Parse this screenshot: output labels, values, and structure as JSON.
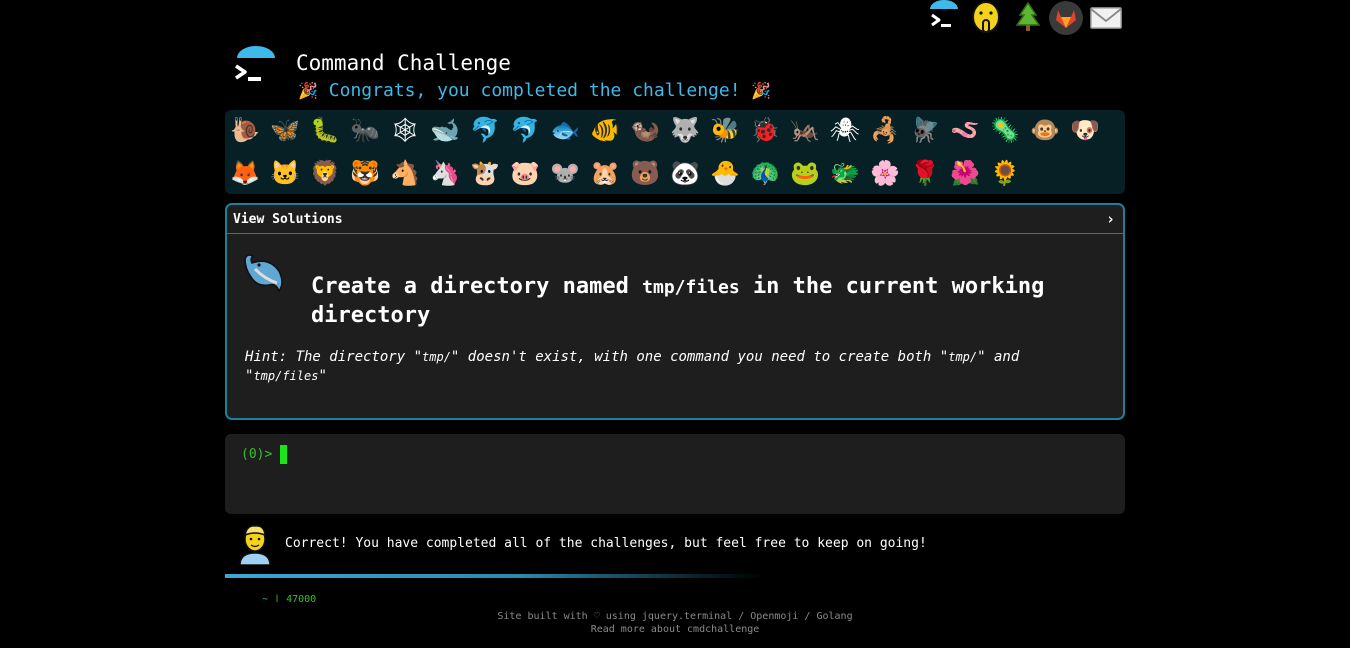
{
  "nav": {
    "icons": [
      "terminal-icon",
      "shushing-face-icon",
      "evergreen-tree-icon",
      "gitlab-icon",
      "envelope-icon"
    ]
  },
  "header": {
    "title": "Command Challenge",
    "congrats": "Congrats, you completed the challenge!"
  },
  "badges": {
    "row1": [
      "🐌",
      "🦋",
      "🐛",
      "🐜",
      "🕸",
      "🐋",
      "🐬",
      "🐬",
      "🐟",
      "🐠",
      "🦦",
      "🐺",
      "🐝",
      "🐞",
      "🦗",
      "🕷",
      "🦂",
      "🪰",
      "🪱",
      "🦠",
      "🐵",
      "🐶"
    ],
    "row2": [
      "🦊",
      "🐱",
      "🦁",
      "🐯",
      "🐴",
      "🦄",
      "🐮",
      "🐷",
      "🐭",
      "🐹",
      "🐻",
      "🐼",
      "🐣",
      "🦚",
      "🐸",
      "🐲",
      "🌸",
      "🌹",
      "🌺",
      "🌻"
    ]
  },
  "panel": {
    "header_label": "View Solutions",
    "chevron": "›",
    "title_before": "Create a directory named",
    "title_code": "tmp/files",
    "title_after": "in the current working directory",
    "hint_prefix": "Hint: The directory \"",
    "hint_code1": "tmp/",
    "hint_mid": "\" doesn't exist, with one command you need to create both \"",
    "hint_code2": "tmp/",
    "hint_and": "\" and",
    "hint_q1": "\"",
    "hint_code3": "tmp/files",
    "hint_q2": "\""
  },
  "terminal": {
    "prompt": "(0)>"
  },
  "message": {
    "text": "Correct! You have completed all of the challenges, but feel free to keep on going!"
  },
  "scroll_text": "~ | 47000",
  "footer": {
    "line1": "Site built with ♡ using jquery.terminal / Openmoji / Golang",
    "line2": "Read more about cmdchallenge"
  },
  "colors": {
    "accent": "#3fb8ea",
    "border": "#1f7f9b",
    "prompt": "#34c12c",
    "badge_bg": "#072026"
  }
}
